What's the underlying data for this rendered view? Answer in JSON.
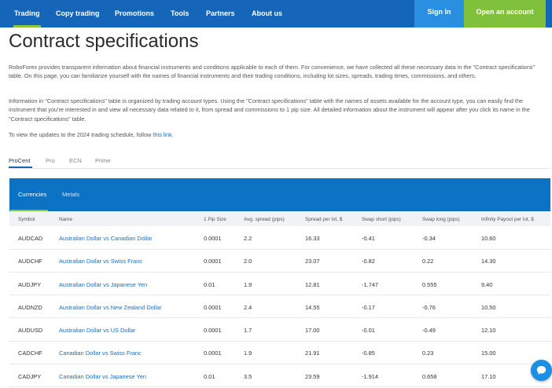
{
  "nav": {
    "items": [
      {
        "label": "Trading"
      },
      {
        "label": "Copy trading"
      },
      {
        "label": "Promotions"
      },
      {
        "label": "Tools"
      },
      {
        "label": "Partners"
      },
      {
        "label": "About us"
      }
    ],
    "signin": "Sign In",
    "open_account": "Open an account"
  },
  "page": {
    "title": "Contract specifications",
    "para1": "RoboForex provides transparent information about financial instruments and conditions applicable to each of them. For convenience, we have collected all these necessary data in the \"Contract specifications\" table. On this page, you can familiarize yourself with the names of financial instruments and their trading conditions, including lot sizes, spreads, trading times, commissions, and others.",
    "para2": "Information in \"Contract specifications\" table is organized by trading account types. Using the \"Contract specifications\" table with the names of assets available for the account type, you can easily find the instrument that you're interested in and view all necessary data related to it, from spread and commissions to 1 pip size. All detailed information about the instrument will appear after you click its name in the \"Contract specifications\" table.",
    "para3_prefix": "To view the updates to the 2024 trading schedule, follow ",
    "para3_link": "this link",
    "para3_suffix": "."
  },
  "account_tabs": [
    "ProCent",
    "Pro",
    "ECN",
    "Prime"
  ],
  "instrument_tabs": [
    "Currencies",
    "Metals"
  ],
  "table": {
    "headers": [
      "Symbol",
      "Name",
      "1 Pip Size",
      "Avg. spread (pips)",
      "Spread per lot, $",
      "Swap short (pips)",
      "Swap long (pips)",
      "Infinity Payout per lot, $"
    ],
    "rows": [
      [
        "AUDCAD",
        "Australian Dollar vs Canadian Dollar",
        "0.0001",
        "2.2",
        "16.33",
        "-0.41",
        "-0.34",
        "10.60"
      ],
      [
        "AUDCHF",
        "Australian Dollar vs Swiss Franc",
        "0.0001",
        "2.0",
        "23.07",
        "-0.82",
        "0.22",
        "14.30"
      ],
      [
        "AUDJPY",
        "Australian Dollar vs Japanese Yen",
        "0.01",
        "1.9",
        "12.81",
        "-1.747",
        "0.555",
        "9.40"
      ],
      [
        "AUDNZD",
        "Australian Dollar vs New Zealand Dollar",
        "0.0001",
        "2.4",
        "14.55",
        "-0.17",
        "-0.76",
        "10.50"
      ],
      [
        "AUDUSD",
        "Australian Dollar vs US Dollar",
        "0.0001",
        "1.7",
        "17.00",
        "-0.01",
        "-0.49",
        "12.10"
      ],
      [
        "CADCHF",
        "Canadian Dollar vs Swiss Franc",
        "0.0001",
        "1.9",
        "21.91",
        "-0.85",
        "0.23",
        "15.00"
      ],
      [
        "CADJPY",
        "Canadian Dollar vs Japanese Yen",
        "0.01",
        "3.5",
        "23.59",
        "-1.914",
        "0.658",
        "17.10"
      ]
    ]
  },
  "chat": {
    "icon": "chat-icon"
  },
  "colors": {
    "nav_bg": "#1565b8",
    "accent_green": "#7fc13b",
    "link": "#1a6fc4",
    "tab_bar": "#0b72c4"
  }
}
